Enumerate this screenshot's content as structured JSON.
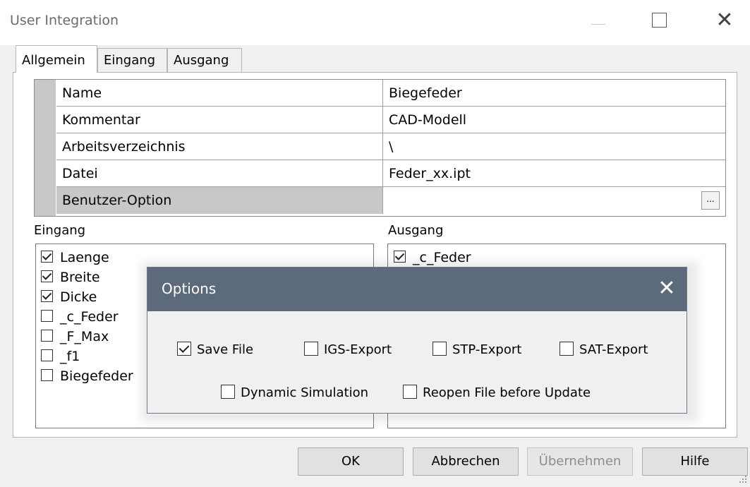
{
  "window": {
    "title": "User Integration",
    "close_glyph": "✕"
  },
  "tabs": [
    {
      "label": "Allgemein",
      "active": true
    },
    {
      "label": "Eingang",
      "active": false
    },
    {
      "label": "Ausgang",
      "active": false
    }
  ],
  "properties": [
    {
      "name": "Name",
      "value": "Biegefeder"
    },
    {
      "name": "Kommentar",
      "value": "CAD-Modell"
    },
    {
      "name": "Arbeitsverzeichnis",
      "value": "\\"
    },
    {
      "name": "Datei",
      "value": "Feder_xx.ipt"
    },
    {
      "name": "Benutzer-Option",
      "value": ""
    }
  ],
  "browse_button_label": "...",
  "input_list": {
    "label": "Eingang",
    "items": [
      {
        "label": "Laenge",
        "checked": true
      },
      {
        "label": "Breite",
        "checked": true
      },
      {
        "label": "Dicke",
        "checked": true
      },
      {
        "label": "_c_Feder",
        "checked": false
      },
      {
        "label": "_F_Max",
        "checked": false
      },
      {
        "label": "_f1",
        "checked": false
      },
      {
        "label": "Biegefeder",
        "checked": false
      }
    ]
  },
  "output_list": {
    "label": "Ausgang",
    "items": [
      {
        "label": "_c_Feder",
        "checked": true
      }
    ]
  },
  "options_dialog": {
    "title": "Options",
    "close_glyph": "✕",
    "checkboxes": [
      {
        "label": "Save File",
        "checked": true
      },
      {
        "label": "IGS-Export",
        "checked": false
      },
      {
        "label": "STP-Export",
        "checked": false
      },
      {
        "label": "SAT-Export",
        "checked": false
      },
      {
        "label": "Dynamic Simulation",
        "checked": false
      },
      {
        "label": "Reopen File before Update",
        "checked": false
      }
    ]
  },
  "buttons": {
    "ok": "OK",
    "cancel": "Abbrechen",
    "apply": "Übernehmen",
    "help": "Hilfe"
  },
  "colors": {
    "options_header": "#5c6a7c",
    "disabled_text": "#8d8d8d"
  }
}
